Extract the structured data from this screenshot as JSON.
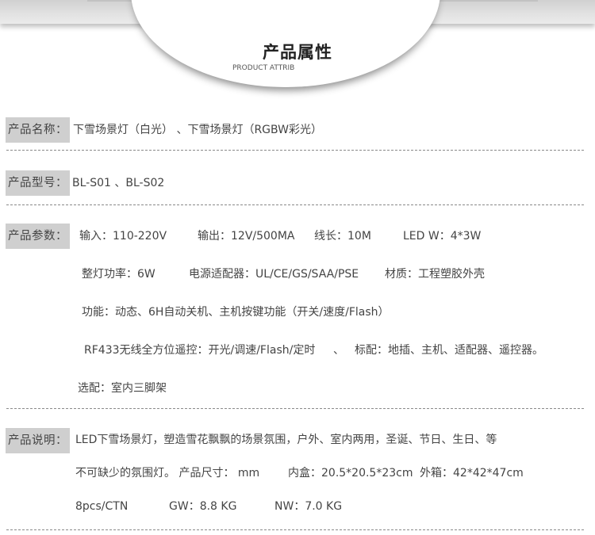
{
  "header": {
    "title": "产品属性",
    "subtitle": "PRODUCT ATTRIB"
  },
  "name": {
    "label": "产品名称：",
    "value": "下雪场景灯（白光）  、下雪场景灯（RGBW彩光）"
  },
  "model": {
    "label": "产品型号：",
    "value": "BL-S01 、BL-S02"
  },
  "params": {
    "label": "产品参数：",
    "input": "输入：110-220V",
    "output": "输出：12V/500MA",
    "cable": "线长：10M",
    "led": "LED W：4*3W",
    "power": "整灯功率：6W",
    "adapter": "电源适配器：UL/CE/GS/SAA/PSE",
    "material": "材质：工程塑胶外壳",
    "function": "功能：动态、6H自动关机、主机按键功能（开关/速度/Flash）",
    "remote": "RF433无线全方位遥控：开光/调速/Flash/定时",
    "sep": "、",
    "standard": "标配：地插、主机、适配器、遥控器。",
    "optional": "选配：室内三脚架"
  },
  "desc": {
    "label": "产品说明：",
    "line1": "LED下雪场景灯，塑造雪花飘飘的场景氛围，户外、室内两用，圣诞、节日、生日、等",
    "line2a": "不可缺少的氛围灯。 产品尺寸：  mm",
    "line2b": "内盒：20.5*20.5*23cm",
    "line2c": "外箱：42*42*47cm",
    "pcs": "8pcs/CTN",
    "gw": "GW：8.8 KG",
    "nw": "NW：7.0 KG"
  }
}
